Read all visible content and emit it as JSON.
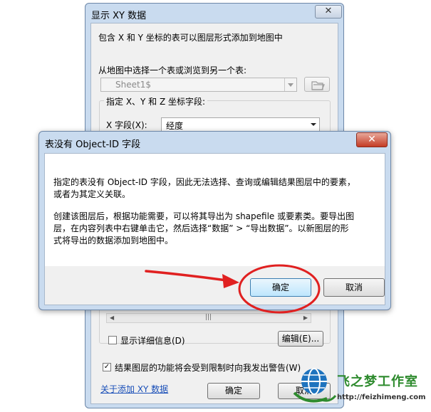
{
  "back_dialog": {
    "title": "显示 XY 数据",
    "close_glyph": "✕",
    "intro": "包含 X 和 Y 坐标的表可以图层形式添加到地图中",
    "choose_label": "从地图中选择一个表或浏览到另一个表:",
    "table_value": "Sheet1$",
    "group_title": "指定 X、Y 和 Z 坐标字段:",
    "x_label": "X 字段(X):",
    "x_value": "经度",
    "show_details": "显示详细信息(D)",
    "edit_button": "编辑(E)...",
    "warn_checkbox": "结果图层的功能将会受到限制时向我发出警告(W)",
    "about_link": "关于添加 XY 数据",
    "ok_button": "确定",
    "cancel_button": "取消",
    "scroll_thumb": "|||",
    "check_mark": "✓"
  },
  "front_dialog": {
    "title": "表没有 Object-ID 字段",
    "close_glyph": "✕",
    "message_1_line_1": "指定的表没有 Object-ID 字段，因此无法选择、查询或编辑结果图层中的要素，",
    "message_1_line_2": "或者为其定义关联。",
    "message_2_line_1": "创建该图层后，根据功能需要，可以将其导出为 shapefile 或要素类。要导出图",
    "message_2_line_2": "层，在内容列表中右键单击它，然后选择“数据” > “导出数据”。以新图层的形",
    "message_2_line_3": "式将导出的数据添加到地图中。",
    "ok_button": "确定",
    "cancel_button": "取消"
  },
  "watermark": {
    "brand": "飞之梦工作室",
    "url": "http://feizhimeng.com"
  },
  "colors": {
    "annotation_red": "#e02020",
    "brand_green": "#2e8b2e",
    "dialog_frame": "#c9dbef"
  }
}
